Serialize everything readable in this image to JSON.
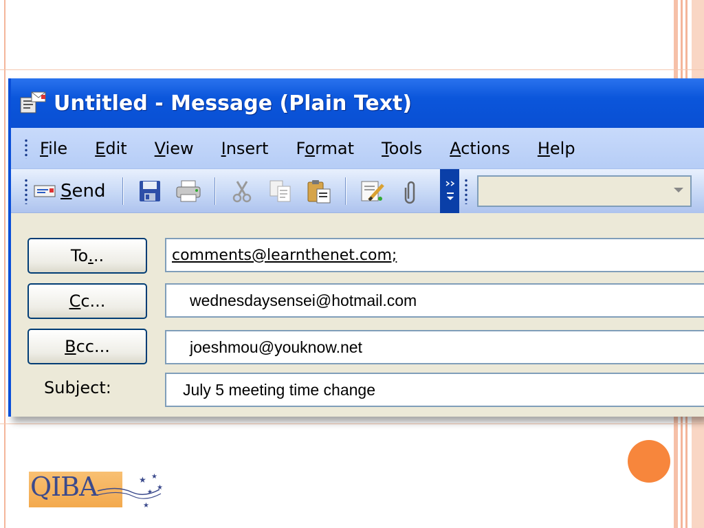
{
  "window": {
    "title": "Untitled - Message (Plain Text)"
  },
  "menu": {
    "items": [
      {
        "pre": "",
        "u": "F",
        "post": "ile"
      },
      {
        "pre": "",
        "u": "E",
        "post": "dit"
      },
      {
        "pre": "",
        "u": "V",
        "post": "iew"
      },
      {
        "pre": "",
        "u": "I",
        "post": "nsert"
      },
      {
        "pre": "F",
        "u": "o",
        "post": "rmat"
      },
      {
        "pre": "",
        "u": "T",
        "post": "ools"
      },
      {
        "pre": "",
        "u": "A",
        "post": "ctions"
      },
      {
        "pre": "",
        "u": "H",
        "post": "elp"
      }
    ]
  },
  "toolbar": {
    "send_u": "S",
    "send_rest": "end",
    "icons": [
      "save-icon",
      "print-icon",
      "cut-icon",
      "copy-icon",
      "paste-icon",
      "edit-icon",
      "attach-icon"
    ]
  },
  "form": {
    "to_label_pre": "To",
    "to_label_u": ".",
    "to_label_post": "..",
    "cc_label_u": "C",
    "cc_label_post": "c...",
    "bcc_label_u": "B",
    "bcc_label_post": "cc...",
    "subject_label_pre": "Sub",
    "subject_label_u": "j",
    "subject_label_post": "ect:",
    "to_value": "comments@learnthenet.com;",
    "cc_value": "wednesdaysensei@hotmail.com",
    "bcc_value": "joeshmou@youknow.net",
    "subject_value": "July 5 meeting time change"
  },
  "logo": {
    "text": "QIBA"
  },
  "colors": {
    "title_bar": "#0b56db",
    "accent_dot": "#f7863c",
    "logo_box": "#f3a94d",
    "logo_text": "#3b4a8c"
  }
}
